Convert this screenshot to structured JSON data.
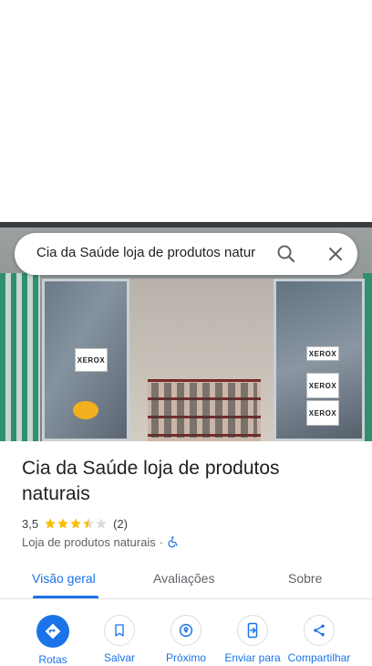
{
  "search": {
    "query": "Cia da Saúde loja de produtos natur"
  },
  "photo": {
    "signs": [
      "XEROX",
      "XEROX",
      "XEROX",
      "XEROX"
    ]
  },
  "place": {
    "name": "Cia da Saúde loja de produtos naturais",
    "rating": "3,5",
    "stars_value": 3.5,
    "review_count": "(2)",
    "category": "Loja de produtos naturais",
    "separator": "·"
  },
  "tabs": [
    {
      "label": "Visão geral",
      "active": true
    },
    {
      "label": "Avaliações",
      "active": false
    },
    {
      "label": "Sobre",
      "active": false
    }
  ],
  "actions": [
    {
      "label": "Rotas",
      "icon": "directions-icon"
    },
    {
      "label": "Salvar",
      "icon": "bookmark-icon"
    },
    {
      "label": "Próximo",
      "icon": "nearby-icon"
    },
    {
      "label": "Enviar para",
      "icon": "send-to-phone-icon"
    },
    {
      "label": "Compartilhar",
      "icon": "share-icon"
    }
  ],
  "colors": {
    "accent": "#1a73e8",
    "star": "#fbbc04",
    "star_empty": "#dadce0"
  }
}
